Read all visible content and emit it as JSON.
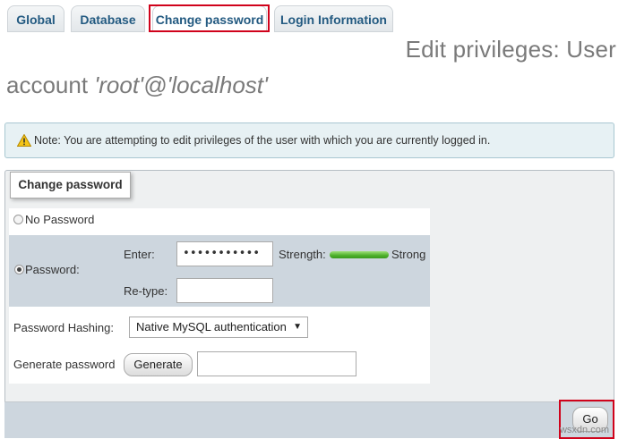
{
  "tabs": [
    {
      "label": "Global"
    },
    {
      "label": "Database"
    },
    {
      "label": "Change password"
    },
    {
      "label": "Login Information"
    }
  ],
  "header": {
    "title_part1": "Edit privileges: User",
    "title_prefix": "account ",
    "title_account": "'root'@'localhost'"
  },
  "notice": {
    "text": "Note: You are attempting to edit privileges of the user with which you are currently logged in."
  },
  "form": {
    "legend": "Change password",
    "no_password_label": "No Password",
    "password_label": "Password:",
    "enter_label": "Enter:",
    "enter_value": "•••••••••••",
    "strength_label": "Strength:",
    "strength_value": "Strong",
    "retype_label": "Re-type:",
    "hashing_label": "Password Hashing:",
    "hashing_selected": "Native MySQL authentication",
    "generate_label": "Generate password",
    "generate_button": "Generate",
    "go_button": "Go"
  },
  "watermark": "wsxdn.com",
  "colors": {
    "accent_red": "#d0021b",
    "notice_bg": "#e7f1f4",
    "shade_bg": "#cdd6de",
    "strength_green": "#4caf2a"
  },
  "icons": {
    "notice": "warning-icon"
  }
}
